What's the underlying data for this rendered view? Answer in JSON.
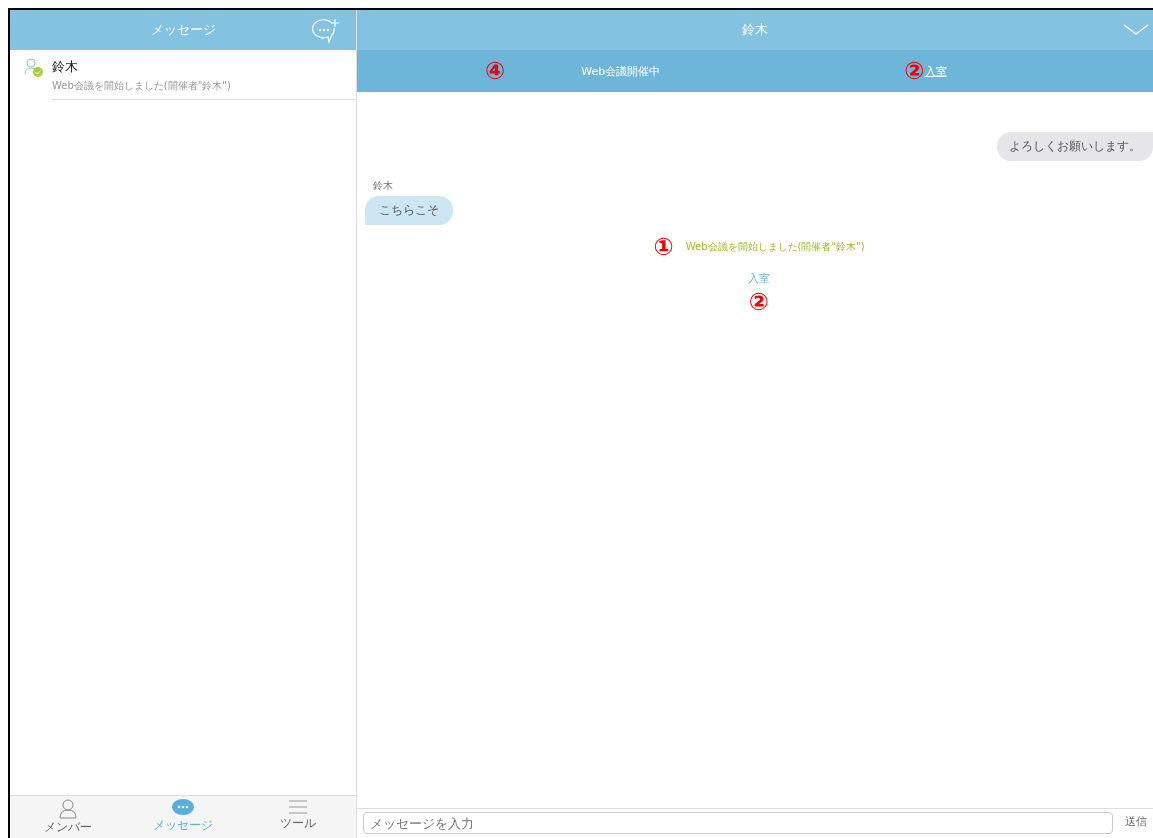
{
  "sidebar": {
    "title": "メッセージ",
    "conversations": [
      {
        "name": "鈴木",
        "preview": "Web会議を開始しました(開催者\"鈴木\")",
        "online": true
      }
    ]
  },
  "tab_bar": [
    {
      "label": "メンバー",
      "selected": false
    },
    {
      "label": "メッセージ",
      "selected": true
    },
    {
      "label": "ツール",
      "selected": false
    }
  ],
  "chat": {
    "title": "鈴木",
    "banner": {
      "status": "Web会議開催中",
      "link": "入室",
      "status_mark": "④",
      "link_mark": "②"
    },
    "messages": [
      {
        "kind": "outgoing",
        "text": "よろしくお願いします。"
      },
      {
        "kind": "incoming",
        "sender": "鈴木",
        "text": "こちらこそ"
      },
      {
        "kind": "system",
        "text": "Web会議を開始しました(開催者\"鈴木\")",
        "mark": "①"
      },
      {
        "kind": "link",
        "text": "入室",
        "mark": "②"
      }
    ],
    "input": {
      "placeholder": "メッセージを入力"
    },
    "send": "送信"
  }
}
